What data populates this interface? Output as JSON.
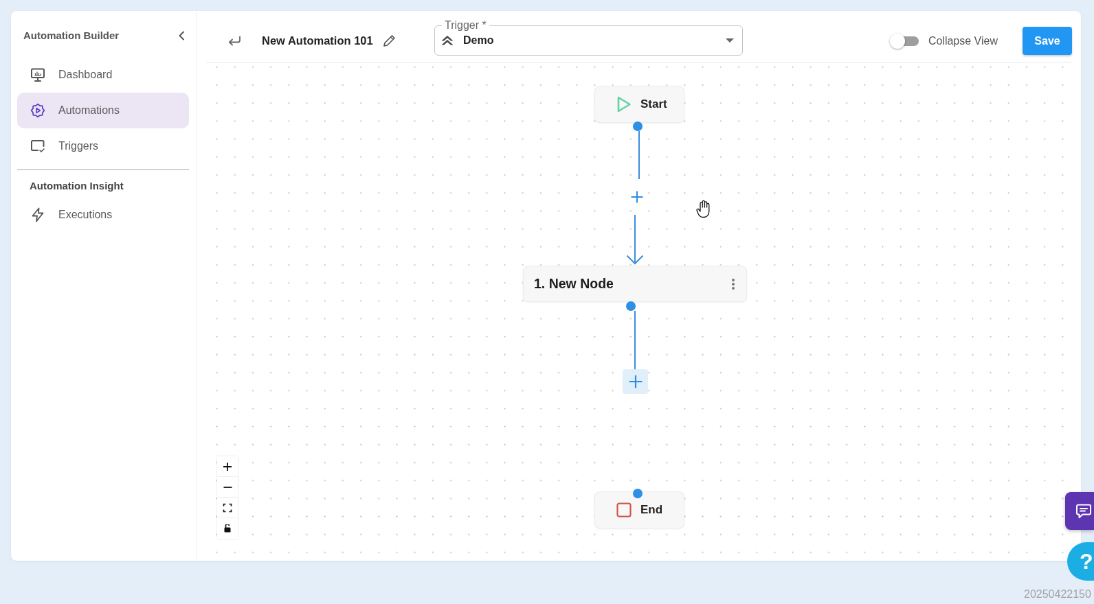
{
  "sidebar": {
    "title": "Automation Builder",
    "items": [
      {
        "label": "Dashboard",
        "selected": false
      },
      {
        "label": "Automations",
        "selected": true
      },
      {
        "label": "Triggers",
        "selected": false
      }
    ],
    "section": {
      "heading": "Automation Insight",
      "items": [
        {
          "label": "Executions",
          "selected": false
        }
      ]
    }
  },
  "header": {
    "automation_name": "New Automation 101",
    "trigger": {
      "label": "Trigger *",
      "value": "Demo"
    },
    "collapse_view": {
      "label": "Collapse View",
      "on": false
    },
    "save_button": "Save"
  },
  "canvas": {
    "nodes": [
      {
        "kind": "start",
        "label": "Start"
      },
      {
        "kind": "step",
        "label": "1. New Node"
      },
      {
        "kind": "end",
        "label": "End"
      }
    ]
  },
  "help_button": "?",
  "build_stamp": "20250422150"
}
